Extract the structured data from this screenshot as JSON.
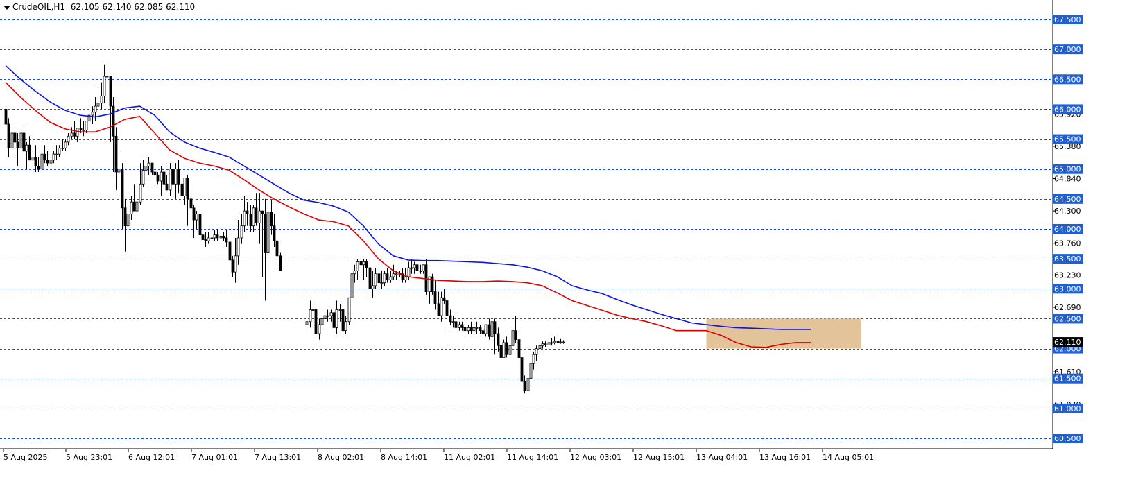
{
  "header": {
    "symbol": "CrudeOIL,H1",
    "ohlc": "62.105 62.140 62.085 62.110"
  },
  "colors": {
    "background": "#ffffff",
    "grid": "#1f4fbf",
    "bull_body": "#ffffff",
    "bear_body": "#000000",
    "wick": "#000000",
    "ma_fast": "#e00000",
    "ma_slow": "#0a14e6",
    "zone": "#deb887",
    "price_label_bg": "#1f5fd0",
    "current_price_bg": "#000000"
  },
  "chart_data": {
    "type": "candlestick",
    "ylim": [
      60.4,
      67.75
    ],
    "y_grid_levels": [
      67.5,
      67.0,
      66.5,
      66.0,
      65.5,
      65.0,
      64.5,
      64.0,
      63.5,
      63.0,
      62.5,
      62.0,
      61.5,
      61.0,
      60.5
    ],
    "y_grid_labels": [
      "67.500",
      "67.000",
      "66.500",
      "66.000",
      "65.500",
      "65.000",
      "64.500",
      "64.000",
      "63.500",
      "63.000",
      "62.500",
      "62.000",
      "61.500",
      "61.000",
      "60.500"
    ],
    "y_tick_labels": [
      "65.920",
      "65.380",
      "64.840",
      "64.300",
      "63.760",
      "63.230",
      "62.690",
      "61.610",
      "61.070"
    ],
    "y_tick_values": [
      65.92,
      65.38,
      64.84,
      64.3,
      63.76,
      63.23,
      62.69,
      61.61,
      61.07
    ],
    "current_price": 62.11,
    "current_price_label": "62.110",
    "x_labels": [
      "5 Aug 2025",
      "5 Aug 23:01",
      "6 Aug 12:01",
      "7 Aug 01:01",
      "7 Aug 13:01",
      "8 Aug 02:01",
      "8 Aug 14:01",
      "11 Aug 02:01",
      "11 Aug 14:01",
      "12 Aug 03:01",
      "12 Aug 15:01",
      "13 Aug 04:01",
      "13 Aug 16:01",
      "14 Aug 05:01"
    ],
    "zone": {
      "x_from": 235,
      "x_to": 287,
      "y_from": 62.0,
      "y_to": 62.5
    },
    "series": [
      {
        "name": "",
        "kind": "ma",
        "color": "#0a14e6",
        "x": [
          0,
          5,
          10,
          15,
          20,
          25,
          30,
          35,
          40,
          45,
          50,
          55,
          60,
          65,
          70,
          75,
          80,
          85,
          90,
          95,
          100,
          105,
          110,
          115,
          120,
          125,
          130,
          135,
          140,
          145,
          150,
          155,
          160,
          165,
          170,
          175,
          180,
          185,
          190,
          195,
          200,
          205,
          210,
          215,
          220,
          225,
          230,
          235,
          240,
          245,
          250,
          255,
          260,
          265,
          270
        ],
        "values": [
          66.73,
          66.5,
          66.3,
          66.12,
          65.98,
          65.9,
          65.87,
          65.92,
          66.02,
          66.05,
          65.9,
          65.62,
          65.45,
          65.35,
          65.28,
          65.2,
          65.05,
          64.9,
          64.75,
          64.6,
          64.48,
          64.44,
          64.38,
          64.28,
          64.05,
          63.75,
          63.55,
          63.48,
          63.47,
          63.47,
          63.46,
          63.45,
          63.44,
          63.42,
          63.4,
          63.36,
          63.3,
          63.2,
          63.05,
          62.98,
          62.92,
          62.82,
          62.73,
          62.65,
          62.57,
          62.5,
          62.43,
          62.4,
          62.37,
          62.35,
          62.34,
          62.33,
          62.32,
          62.32,
          62.32
        ]
      },
      {
        "name": "",
        "kind": "ma",
        "color": "#e00000",
        "x": [
          0,
          5,
          10,
          15,
          20,
          25,
          30,
          35,
          40,
          45,
          50,
          55,
          60,
          65,
          70,
          75,
          80,
          85,
          90,
          95,
          100,
          105,
          110,
          115,
          120,
          125,
          130,
          135,
          140,
          145,
          150,
          155,
          160,
          165,
          170,
          175,
          180,
          185,
          190,
          195,
          200,
          205,
          210,
          215,
          220,
          225,
          230,
          235,
          240,
          245,
          250,
          255,
          260,
          265,
          270
        ],
        "values": [
          66.45,
          66.2,
          65.98,
          65.78,
          65.67,
          65.62,
          65.62,
          65.7,
          65.83,
          65.88,
          65.6,
          65.32,
          65.18,
          65.1,
          65.05,
          64.98,
          64.82,
          64.65,
          64.5,
          64.37,
          64.25,
          64.15,
          64.12,
          64.05,
          63.8,
          63.5,
          63.3,
          63.2,
          63.17,
          63.14,
          63.13,
          63.12,
          63.12,
          63.13,
          63.12,
          63.1,
          63.05,
          62.93,
          62.8,
          62.72,
          62.64,
          62.56,
          62.5,
          62.45,
          62.38,
          62.3,
          62.3,
          62.3,
          62.22,
          62.1,
          62.03,
          62.02,
          62.07,
          62.1,
          62.1
        ]
      },
      {
        "name": "",
        "kind": "ohlc",
        "open": [
          66.0,
          65.75,
          65.35,
          65.6,
          65.45,
          65.35,
          65.6,
          65.3,
          65.4,
          65.15,
          65.2,
          65.05,
          65.0,
          65.25,
          65.15,
          65.1,
          65.15,
          65.25,
          65.25,
          65.35,
          65.35,
          65.45,
          65.55,
          65.6,
          65.55,
          65.68,
          65.65,
          65.65,
          65.8,
          65.9,
          65.95,
          66.05,
          66.1,
          66.22,
          66.55,
          66.55,
          66.05,
          65.55,
          64.95,
          65.0,
          64.35,
          64.05,
          64.25,
          64.45,
          64.3,
          64.45,
          64.75,
          64.98,
          65.05,
          65.1,
          64.95,
          64.9,
          64.8,
          64.95,
          64.75,
          64.65,
          65.0,
          64.75,
          65.0,
          64.75,
          64.55,
          64.85,
          64.5,
          64.35,
          64.15,
          64.25,
          63.9,
          63.82,
          63.8,
          63.85,
          63.85,
          63.9,
          63.85,
          63.88,
          63.85,
          63.78,
          63.48,
          63.28,
          63.55,
          63.85,
          64.05,
          64.3,
          64.25,
          64.05,
          64.35,
          64.1,
          64.3,
          64.25,
          63.6,
          64.28,
          64.05,
          63.8,
          63.55
        ],
        "high": [
          66.3,
          65.85,
          65.55,
          65.7,
          65.6,
          65.5,
          65.75,
          65.45,
          65.55,
          65.3,
          65.4,
          65.2,
          65.2,
          65.4,
          65.3,
          65.3,
          65.3,
          65.4,
          65.4,
          65.5,
          65.5,
          65.6,
          65.7,
          65.8,
          65.65,
          65.85,
          65.8,
          65.8,
          66.0,
          66.05,
          66.2,
          66.4,
          66.45,
          66.75,
          66.75,
          66.55,
          66.2,
          65.7,
          65.3,
          65.1,
          64.5,
          64.45,
          64.55,
          64.75,
          64.95,
          65.1,
          65.15,
          65.2,
          65.2,
          65.1,
          64.95,
          64.95,
          65.05,
          65.1,
          64.9,
          65.1,
          65.1,
          65.1,
          65.15,
          64.8,
          64.7,
          64.9,
          64.6,
          64.4,
          64.3,
          64.3,
          64.0,
          63.95,
          63.95,
          64.0,
          63.98,
          64.0,
          63.98,
          63.95,
          63.98,
          63.9,
          63.55,
          63.85,
          64.15,
          64.25,
          64.55,
          64.45,
          64.4,
          64.4,
          64.6,
          64.6,
          64.3,
          64.5,
          64.35,
          64.48,
          64.25,
          63.95,
          63.6
        ],
        "low": [
          65.4,
          65.2,
          65.3,
          65.15,
          65.05,
          65.2,
          65.35,
          65.0,
          65.2,
          65.05,
          64.95,
          64.95,
          64.95,
          65.1,
          65.05,
          65.05,
          65.1,
          65.15,
          65.2,
          65.3,
          65.3,
          65.4,
          65.5,
          65.5,
          65.45,
          65.6,
          65.55,
          65.6,
          65.75,
          65.75,
          65.8,
          65.85,
          66.0,
          66.1,
          66.0,
          65.45,
          64.95,
          64.65,
          64.55,
          64.0,
          63.62,
          63.95,
          64.15,
          64.3,
          64.25,
          64.4,
          64.7,
          64.8,
          64.9,
          64.9,
          64.75,
          64.75,
          64.55,
          64.1,
          64.65,
          64.55,
          64.65,
          64.5,
          64.6,
          64.45,
          64.4,
          64.05,
          64.05,
          63.85,
          64.0,
          63.85,
          63.75,
          63.7,
          63.75,
          63.75,
          63.8,
          63.8,
          63.75,
          63.8,
          63.7,
          63.55,
          63.2,
          63.1,
          63.4,
          63.75,
          63.95,
          64.05,
          63.95,
          63.95,
          64.05,
          63.75,
          63.2,
          62.8,
          62.95,
          63.9,
          63.7,
          63.45,
          63.3
        ],
        "close": [
          65.75,
          65.35,
          65.6,
          65.45,
          65.35,
          65.6,
          65.3,
          65.4,
          65.15,
          65.2,
          65.05,
          65.0,
          65.25,
          65.15,
          65.1,
          65.15,
          65.25,
          65.25,
          65.35,
          65.35,
          65.45,
          65.55,
          65.6,
          65.55,
          65.68,
          65.65,
          65.65,
          65.8,
          65.9,
          65.95,
          66.05,
          66.1,
          66.22,
          66.55,
          66.55,
          66.05,
          65.55,
          64.95,
          65.0,
          64.35,
          64.05,
          64.25,
          64.45,
          64.3,
          64.45,
          64.75,
          64.98,
          65.05,
          65.1,
          64.95,
          64.9,
          64.8,
          64.95,
          64.75,
          64.65,
          65.0,
          64.75,
          65.0,
          64.75,
          64.55,
          64.85,
          64.5,
          64.35,
          64.15,
          64.25,
          63.9,
          63.82,
          63.8,
          63.85,
          63.85,
          63.9,
          63.85,
          63.88,
          63.85,
          63.78,
          63.48,
          63.28,
          63.55,
          63.85,
          64.05,
          64.3,
          64.25,
          64.05,
          64.35,
          64.1,
          64.3,
          64.25,
          63.6,
          64.28,
          64.05,
          63.8,
          63.55,
          63.3
        ]
      },
      {
        "name": "",
        "kind": "ohlc",
        "x_start": 101,
        "open": [
          62.4,
          62.45,
          62.65,
          62.65,
          62.25,
          62.4,
          62.5,
          62.55,
          62.55,
          62.6,
          62.35,
          62.65,
          62.65,
          62.3,
          62.45,
          62.85,
          63.25,
          63.3,
          63.45,
          63.4,
          63.45,
          63.35,
          63.0,
          63.05,
          63.25,
          63.1,
          63.1,
          63.25,
          63.15,
          63.2,
          63.25,
          63.25,
          63.25,
          63.15,
          63.2,
          63.35,
          63.35,
          63.4,
          63.3,
          63.3,
          63.4,
          62.95,
          63.2,
          62.95,
          62.75,
          62.55,
          62.85,
          62.8,
          62.55,
          62.45,
          62.45,
          62.35,
          62.4,
          62.35,
          62.3,
          62.35,
          62.3,
          62.35,
          62.35,
          62.3,
          62.25,
          62.4,
          62.2,
          62.45,
          62.25,
          62.05,
          61.85,
          62.1,
          61.9,
          62.05,
          62.3,
          62.15,
          61.85,
          61.45,
          61.3,
          61.5,
          61.75,
          61.9,
          62.0,
          62.05,
          62.08,
          62.06,
          62.1,
          62.1,
          62.12,
          62.1,
          62.11
        ],
        "high": [
          62.5,
          62.8,
          62.7,
          62.75,
          62.5,
          62.55,
          62.65,
          62.65,
          62.65,
          62.75,
          62.8,
          62.75,
          62.75,
          62.55,
          62.75,
          63.25,
          63.4,
          63.5,
          63.5,
          63.5,
          63.5,
          63.45,
          63.3,
          63.35,
          63.4,
          63.3,
          63.3,
          63.35,
          63.3,
          63.4,
          63.3,
          63.3,
          63.35,
          63.35,
          63.45,
          63.5,
          63.45,
          63.45,
          63.4,
          63.4,
          63.5,
          63.2,
          63.25,
          63.15,
          62.95,
          62.95,
          63.0,
          62.9,
          62.65,
          62.55,
          62.55,
          62.45,
          62.45,
          62.4,
          62.4,
          62.45,
          62.4,
          62.45,
          62.4,
          62.35,
          62.4,
          62.5,
          62.55,
          62.5,
          62.35,
          62.2,
          62.15,
          62.2,
          62.2,
          62.35,
          62.55,
          62.3,
          61.95,
          61.55,
          61.55,
          61.85,
          61.95,
          62.05,
          62.1,
          62.12,
          62.12,
          62.13,
          62.18,
          62.2,
          62.24,
          62.16,
          62.14
        ],
        "low": [
          62.35,
          62.35,
          62.4,
          62.2,
          62.15,
          62.3,
          62.4,
          62.45,
          62.45,
          62.35,
          62.25,
          62.45,
          62.25,
          62.25,
          62.4,
          62.8,
          63.1,
          63.15,
          63.0,
          63.15,
          63.2,
          62.85,
          62.85,
          63.0,
          63.05,
          63.0,
          63.05,
          63.1,
          63.1,
          63.15,
          63.15,
          63.2,
          63.1,
          63.1,
          63.15,
          63.25,
          63.25,
          63.25,
          63.25,
          63.25,
          62.9,
          62.75,
          62.9,
          62.65,
          62.55,
          62.45,
          62.75,
          62.35,
          62.4,
          62.35,
          62.3,
          62.3,
          62.3,
          62.25,
          62.25,
          62.25,
          62.25,
          62.25,
          62.25,
          62.2,
          62.2,
          62.15,
          62.15,
          61.9,
          61.95,
          61.85,
          61.85,
          61.85,
          61.9,
          62.0,
          62.1,
          61.85,
          61.4,
          61.25,
          61.25,
          61.35,
          61.65,
          61.8,
          61.95,
          62.0,
          62.03,
          62.03,
          62.05,
          62.07,
          62.05,
          62.08,
          62.08
        ],
        "close": [
          62.45,
          62.65,
          62.65,
          62.25,
          62.4,
          62.5,
          62.55,
          62.55,
          62.6,
          62.35,
          62.65,
          62.65,
          62.3,
          62.45,
          62.85,
          63.25,
          63.3,
          63.45,
          63.4,
          63.45,
          63.35,
          63.0,
          63.05,
          63.25,
          63.1,
          63.1,
          63.25,
          63.15,
          63.2,
          63.25,
          63.25,
          63.25,
          63.15,
          63.2,
          63.35,
          63.35,
          63.4,
          63.3,
          63.3,
          63.4,
          62.95,
          63.2,
          62.95,
          62.75,
          62.55,
          62.85,
          62.8,
          62.55,
          62.45,
          62.45,
          62.35,
          62.4,
          62.35,
          62.3,
          62.35,
          62.3,
          62.35,
          62.35,
          62.3,
          62.25,
          62.4,
          62.2,
          62.45,
          62.25,
          62.05,
          61.85,
          62.1,
          61.9,
          62.05,
          62.3,
          62.15,
          61.85,
          61.45,
          61.3,
          61.5,
          61.75,
          61.9,
          62.0,
          62.05,
          62.08,
          62.06,
          62.1,
          62.1,
          62.12,
          62.1,
          62.11,
          62.11
        ]
      }
    ]
  }
}
